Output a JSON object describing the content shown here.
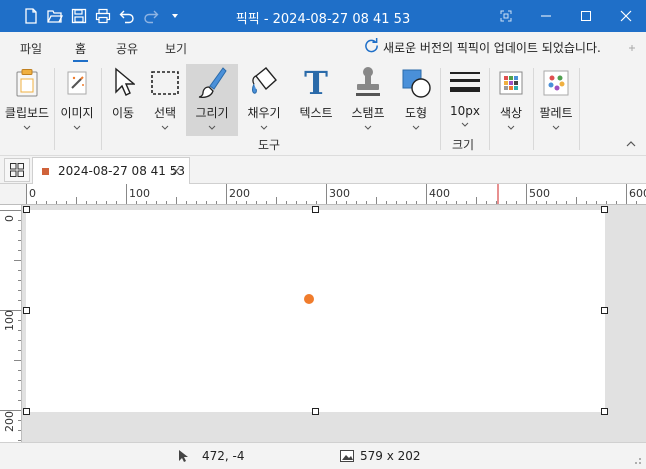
{
  "window": {
    "title": "픽픽 - 2024-08-27 08 41 53"
  },
  "qat": {
    "icons": [
      "new-file-icon",
      "open-folder-icon",
      "save-icon",
      "print-icon",
      "undo-icon",
      "redo-icon",
      "qat-dropdown-icon"
    ]
  },
  "menu": {
    "tabs": [
      "파일",
      "홈",
      "공유",
      "보기"
    ],
    "active": "홈",
    "update_text": "새로운 버전의 픽픽이 업데이트 되었습니다."
  },
  "ribbon": {
    "clipboard": "클립보드",
    "image": "이미지",
    "move": "이동",
    "select": "선택",
    "draw": "그리기",
    "fill": "채우기",
    "text": "텍스트",
    "stamp": "스탬프",
    "shape": "도형",
    "size_value": "10px",
    "color": "색상",
    "palette": "팔레트",
    "group_tools": "도구",
    "group_size": "크기",
    "text_glyph": "T"
  },
  "document": {
    "tab_label": "2024-08-27 08 41 53",
    "close": "×"
  },
  "ruler": {
    "h_labels": [
      "0",
      "100",
      "200",
      "300",
      "400",
      "500",
      "600"
    ],
    "v_labels": [
      "0",
      "100",
      "200"
    ]
  },
  "status": {
    "cursor": "472, -4",
    "image_size": "579 x 202"
  },
  "colors": {
    "accent": "#1f6fc8",
    "dot": "#f07c2c",
    "tab_dot": "#d0623a"
  }
}
